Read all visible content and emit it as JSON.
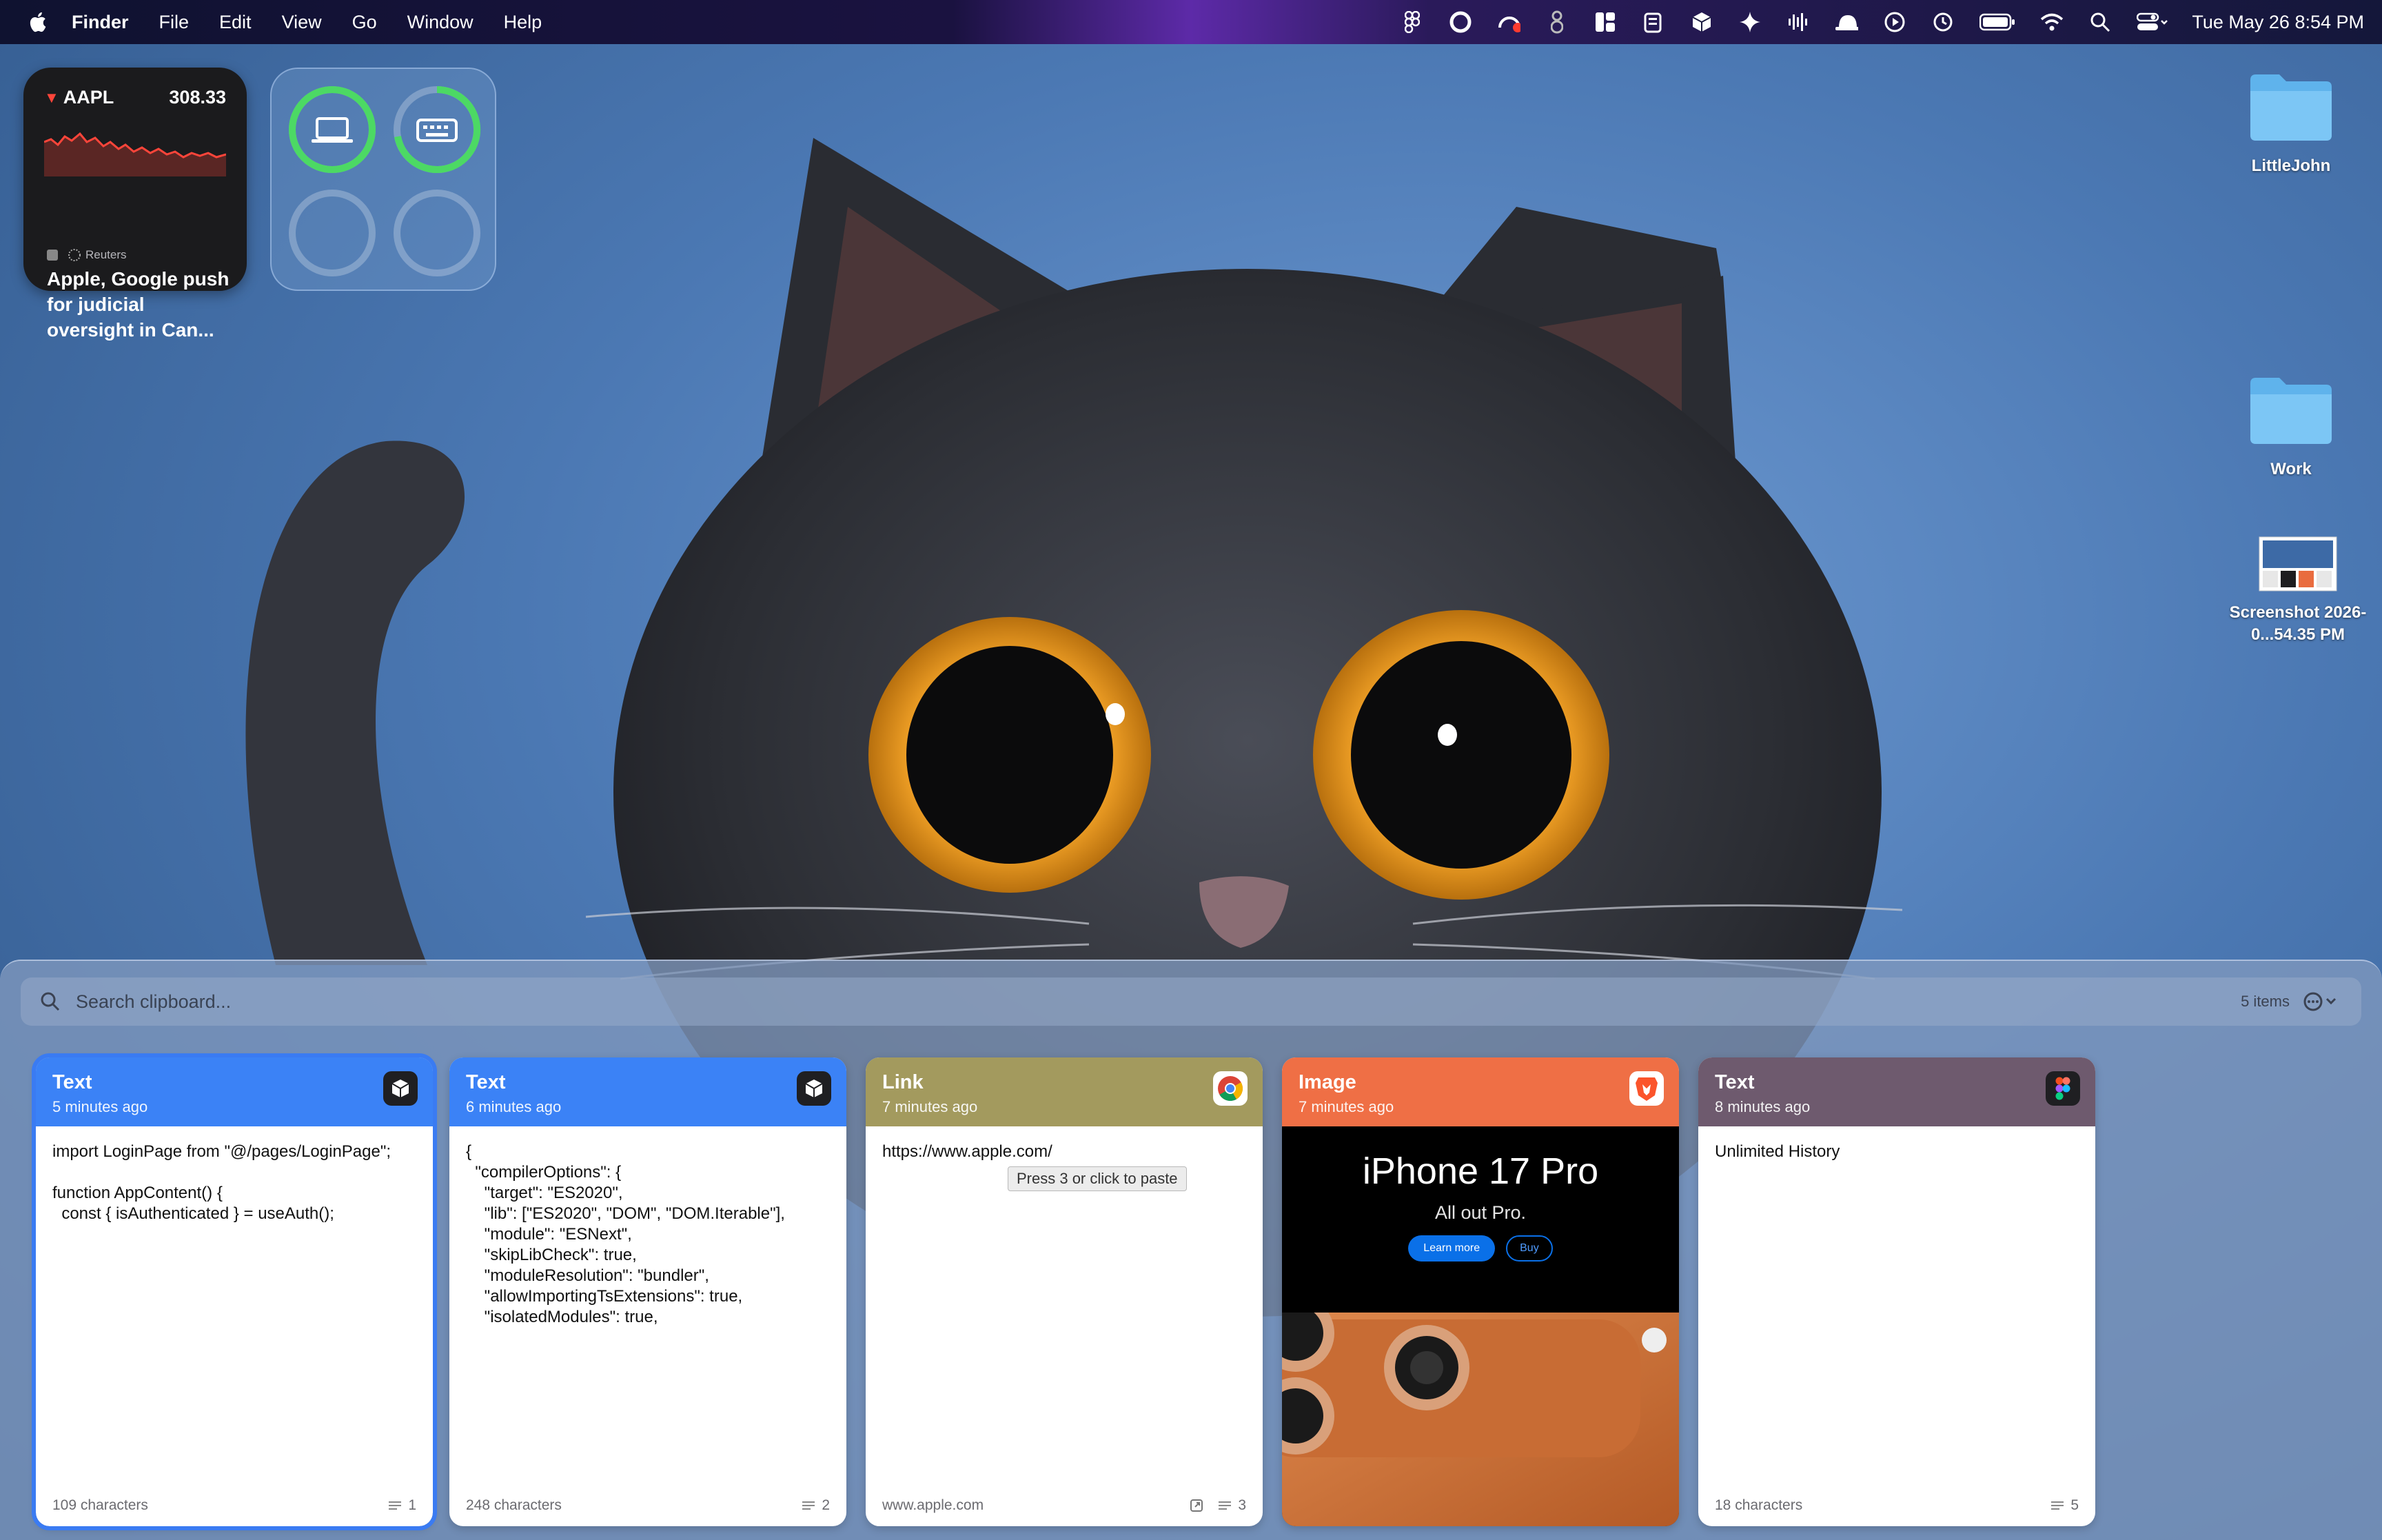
{
  "menubar": {
    "app": "Finder",
    "menus": [
      "File",
      "Edit",
      "View",
      "Go",
      "Window",
      "Help"
    ],
    "clock": "Tue May 26  8:54 PM"
  },
  "widgets": {
    "stock": {
      "symbol": "AAPL",
      "price": "308.33",
      "trend_arrow": "▼",
      "source": "Reuters",
      "headline": "Apple, Google push for judicial oversight in Can..."
    }
  },
  "desktop": {
    "icons": [
      {
        "label": "LittleJohn",
        "kind": "folder"
      },
      {
        "label": "Work",
        "kind": "folder"
      },
      {
        "label": "Screenshot 2026-0...54.35 PM",
        "kind": "screenshot"
      }
    ]
  },
  "clipboard": {
    "search_placeholder": "Search clipboard...",
    "items_count": "5 items",
    "cards": [
      {
        "type": "Text",
        "time": "5 minutes ago",
        "header_color": "#3b82f6",
        "app_icon": "cube-app-icon",
        "content": "import LoginPage from \"@/pages/LoginPage\";\n\nfunction AppContent() {\n  const { isAuthenticated } = useAuth();",
        "footer_left": "109 characters",
        "footer_index": "1",
        "selected": true
      },
      {
        "type": "Text",
        "time": "6 minutes ago",
        "header_color": "#3b82f6",
        "app_icon": "cube-app-icon",
        "content": "{\n  \"compilerOptions\": {\n    \"target\": \"ES2020\",\n    \"lib\": [\"ES2020\", \"DOM\", \"DOM.Iterable\"],\n    \"module\": \"ESNext\",\n    \"skipLibCheck\": true,\n    \"moduleResolution\": \"bundler\",\n    \"allowImportingTsExtensions\": true,\n    \"isolatedModules\": true,",
        "footer_left": "248 characters",
        "footer_index": "2"
      },
      {
        "type": "Link",
        "time": "7 minutes ago",
        "header_color": "#a39a5e",
        "app_icon": "chrome-icon",
        "content": "https://www.apple.com/",
        "tooltip": "Press 3 or click to paste",
        "footer_left": "www.apple.com",
        "footer_index": "3"
      },
      {
        "type": "Image",
        "time": "7 minutes ago",
        "header_color": "#ef6f45",
        "app_icon": "brave-icon",
        "image": {
          "title": "iPhone 17 Pro",
          "subtitle": "All out Pro.",
          "primary_button": "Learn more",
          "secondary_button": "Buy"
        }
      },
      {
        "type": "Text",
        "time": "8 minutes ago",
        "header_color": "#6e5a6e",
        "app_icon": "figma-icon",
        "content": "Unlimited History",
        "footer_left": "18 characters",
        "footer_index": "5"
      }
    ]
  }
}
